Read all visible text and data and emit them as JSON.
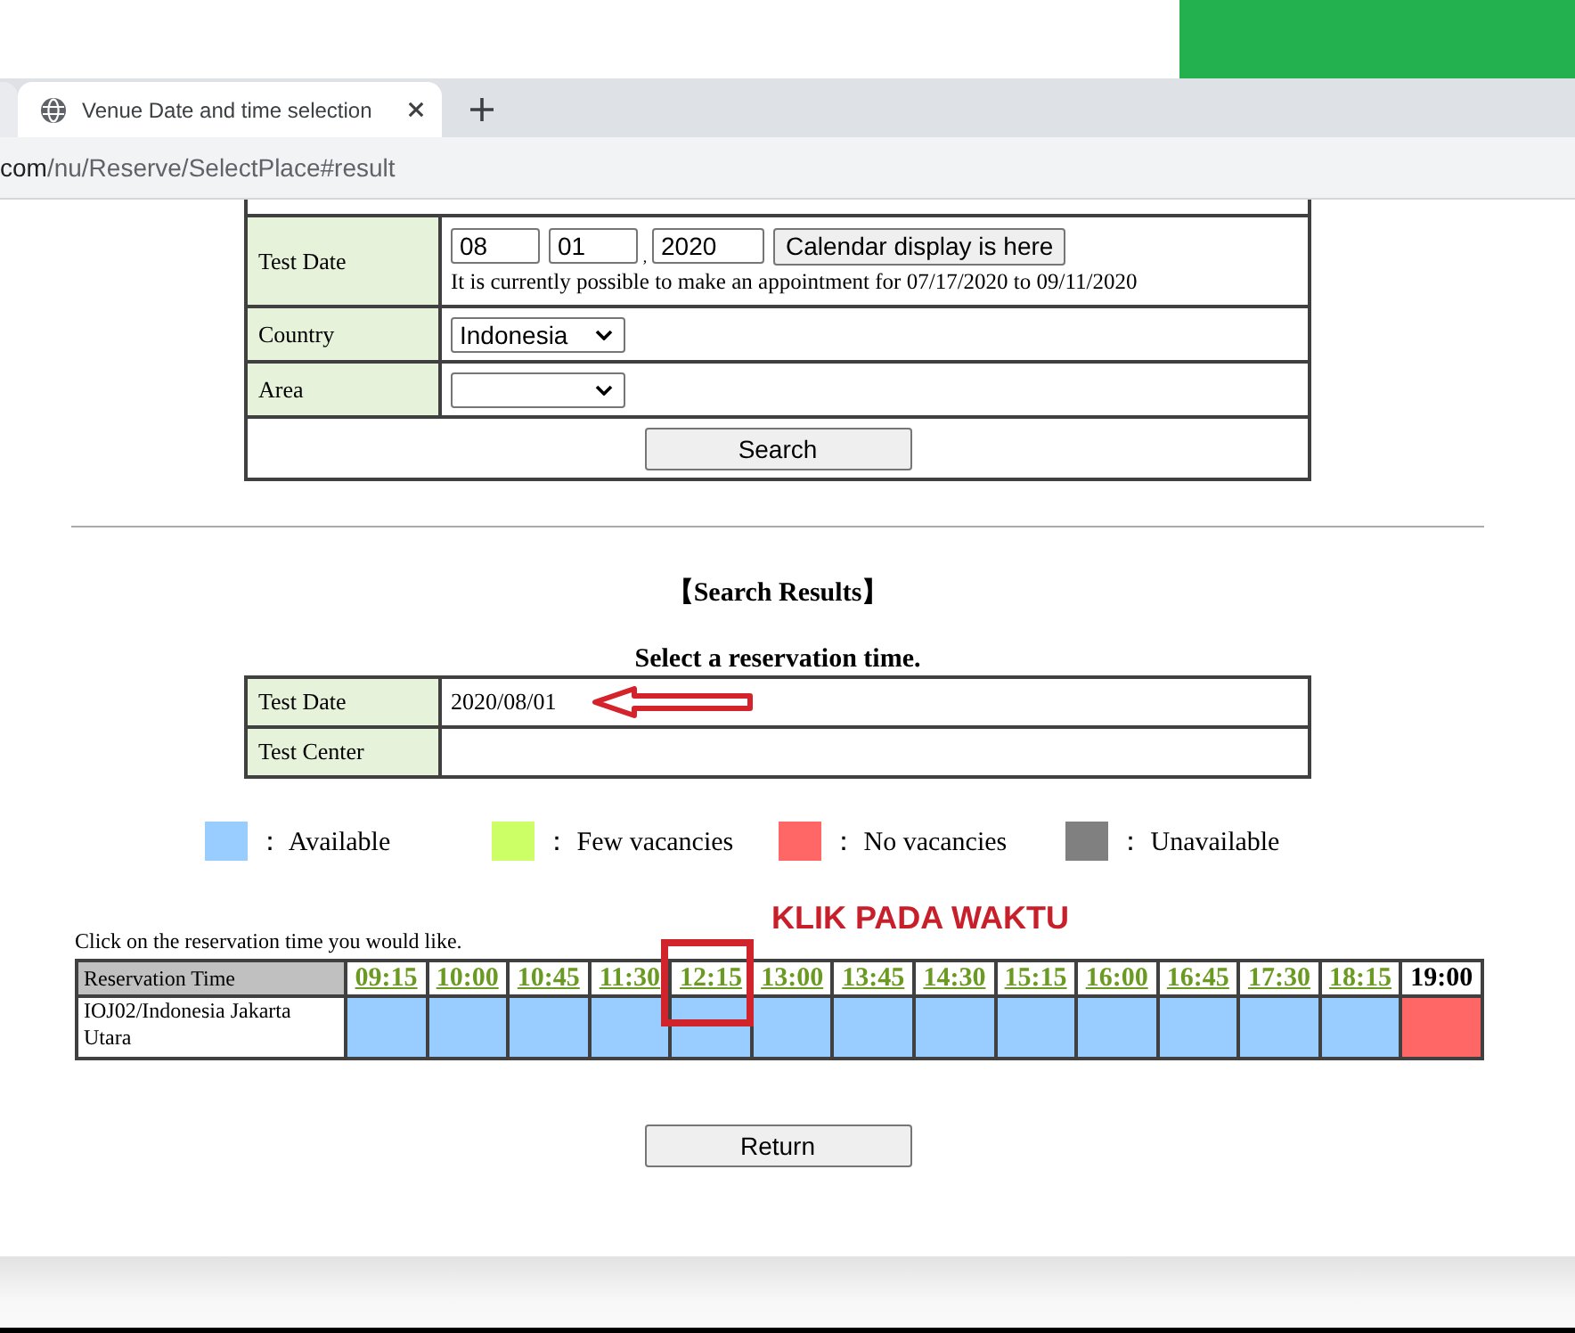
{
  "browser": {
    "tabs": [
      {
        "title": "Venue Date and time selection",
        "selected": true
      }
    ],
    "address": {
      "host": "com",
      "path": "/nu/Reserve/SelectPlace#result"
    }
  },
  "search_form": {
    "rows": [
      {
        "kind": "date",
        "label": "Test Date",
        "month": "08",
        "day": "01",
        "separator": ",",
        "year": "2020",
        "calendar_button": "Calendar display is here",
        "note": "It is currently possible to make an appointment for 07/17/2020 to 09/11/2020"
      },
      {
        "kind": "select",
        "label": "Country",
        "value": "Indonesia"
      },
      {
        "kind": "select",
        "label": "Area"
      }
    ],
    "search_button": "Search"
  },
  "results": {
    "heading": "【Search Results】",
    "subheading": "Select a reservation time.",
    "rows": [
      {
        "label": "Test Date",
        "value": "2020/08/01",
        "arrow": true
      },
      {
        "label": "Test Center",
        "arrow": false
      }
    ]
  },
  "legend": [
    {
      "label": "： Available",
      "color": "#99ccff"
    },
    {
      "label": "： Few vacancies",
      "color": "#ccff66"
    },
    {
      "label": "： No vacancies",
      "color": "#ff6666"
    },
    {
      "label": "： Unavailable",
      "color": "#808080"
    }
  ],
  "time_table": {
    "instruction": "Click on the reservation time you would like.",
    "callout": "KLIK PADA WAKTU",
    "corner": "Reservation Time",
    "venue": "IOJ02/Indonesia Jakarta Utara",
    "slots": [
      {
        "time": "09:15",
        "color": "#99ccff",
        "selectable": true,
        "highlighted": false
      },
      {
        "time": "10:00",
        "color": "#99ccff",
        "selectable": true,
        "highlighted": false
      },
      {
        "time": "10:45",
        "color": "#99ccff",
        "selectable": true,
        "highlighted": false
      },
      {
        "time": "11:30",
        "color": "#99ccff",
        "selectable": true,
        "highlighted": false
      },
      {
        "time": "12:15",
        "color": "#99ccff",
        "selectable": true,
        "highlighted": true
      },
      {
        "time": "13:00",
        "color": "#99ccff",
        "selectable": true,
        "highlighted": false
      },
      {
        "time": "13:45",
        "color": "#99ccff",
        "selectable": true,
        "highlighted": false
      },
      {
        "time": "14:30",
        "color": "#99ccff",
        "selectable": true,
        "highlighted": false
      },
      {
        "time": "15:15",
        "color": "#99ccff",
        "selectable": true,
        "highlighted": false
      },
      {
        "time": "16:00",
        "color": "#99ccff",
        "selectable": true,
        "highlighted": false
      },
      {
        "time": "16:45",
        "color": "#99ccff",
        "selectable": true,
        "highlighted": false
      },
      {
        "time": "17:30",
        "color": "#99ccff",
        "selectable": true,
        "highlighted": false
      },
      {
        "time": "18:15",
        "color": "#99ccff",
        "selectable": true,
        "highlighted": false
      },
      {
        "time": "19:00",
        "color": "#ff6666",
        "selectable": false,
        "highlighted": false
      }
    ]
  },
  "return_button": "Return"
}
